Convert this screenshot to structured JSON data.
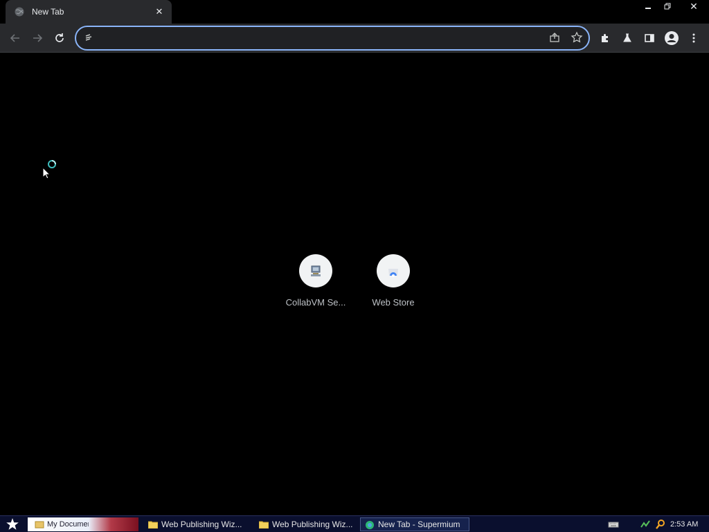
{
  "tab": {
    "title": "New Tab",
    "favicon": "globe-icon",
    "close_icon": "close-icon"
  },
  "window_controls": {
    "minimize": "minimize-icon",
    "restore": "restore-icon",
    "close": "close-icon"
  },
  "toolbar": {
    "back_icon": "arrow-left-icon",
    "forward_icon": "arrow-right-icon",
    "reload_icon": "reload-icon",
    "omnibox": {
      "value": "",
      "placeholder": "",
      "icon": "search-engine-icon"
    },
    "share_icon": "share-icon",
    "bookmark_icon": "star-icon",
    "extensions_icon": "puzzle-icon",
    "labs_icon": "flask-icon",
    "side_panel_icon": "side-panel-icon",
    "profile_icon": "avatar-icon",
    "menu_icon": "kebab-menu-icon"
  },
  "shortcuts": [
    {
      "label": "CollabVM Se...",
      "icon": "collabvm-icon"
    },
    {
      "label": "Web Store",
      "icon": "web-store-icon"
    }
  ],
  "taskbar": {
    "start_icon": "star-icon",
    "quicklaunch_label": "My Documents",
    "buttons": [
      {
        "label": "Web Publishing Wiz...",
        "icon": "folder-icon",
        "active": false
      },
      {
        "label": "Web Publishing Wiz...",
        "icon": "folder-icon",
        "active": false
      },
      {
        "label": "New Tab - Supermium",
        "icon": "browser-icon",
        "active": true
      }
    ],
    "tray": {
      "icons": [
        "keyboard-icon",
        "network-icon",
        "search-icon"
      ],
      "clock": "2:53 AM"
    }
  },
  "colors": {
    "tab_bg": "#292a2d",
    "toolbar_bg": "#292a2d",
    "omnibox_focus": "#8ab4f8",
    "content_bg": "#000000",
    "taskbar_bg": "#0a0f2e"
  }
}
